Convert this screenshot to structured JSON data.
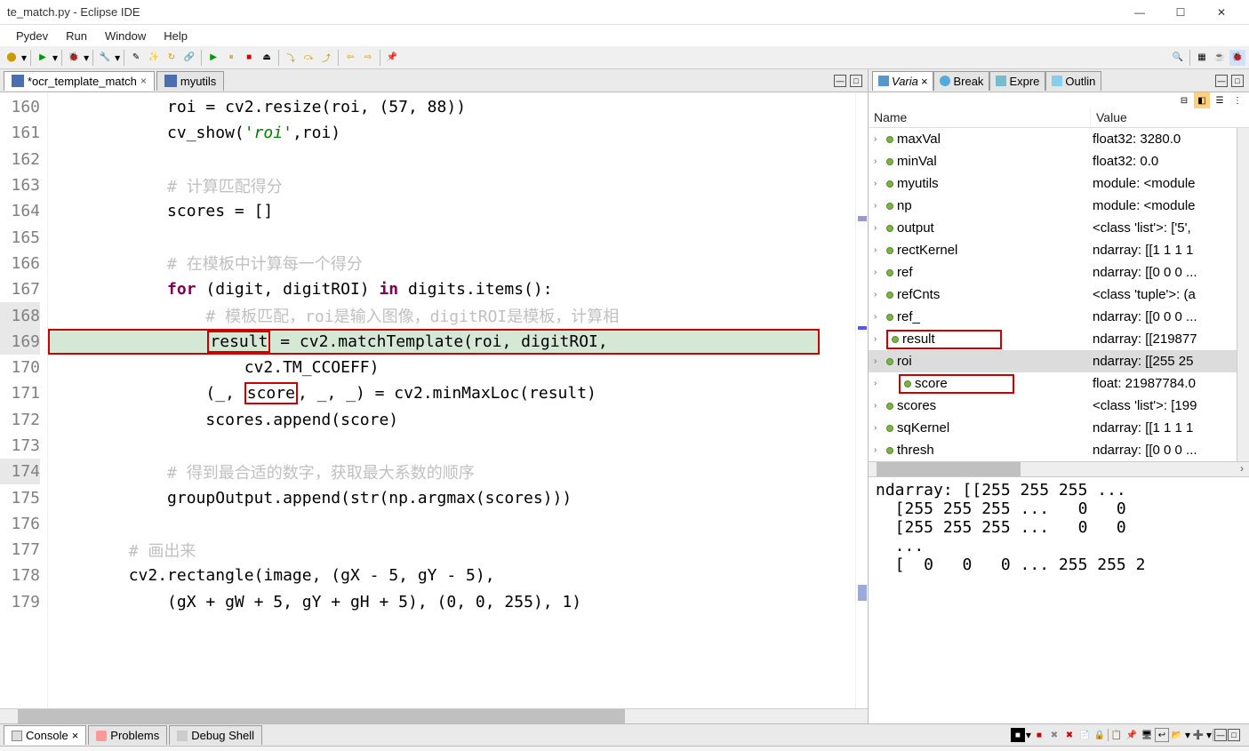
{
  "titlebar": "te_match.py - Eclipse IDE",
  "menu": {
    "pydev": "Pydev",
    "run": "Run",
    "window": "Window",
    "help": "Help"
  },
  "tabs": {
    "active": "*ocr_template_match",
    "second": "myutils"
  },
  "right_tabs": {
    "varia": "Varia",
    "break": "Break",
    "expre": "Expre",
    "outlin": "Outlin"
  },
  "bottom_tabs": {
    "console": "Console",
    "problems": "Problems",
    "debug_shell": "Debug Shell"
  },
  "editor_lines": [
    {
      "n": 160,
      "i": "            ",
      "seg": [
        {
          "t": "roi = cv2.resize(roi, ("
        },
        {
          "t": "57",
          "c": "num"
        },
        {
          "t": ", "
        },
        {
          "t": "88",
          "c": "num"
        },
        {
          "t": "))"
        }
      ]
    },
    {
      "n": 161,
      "i": "            ",
      "seg": [
        {
          "t": "cv_show("
        },
        {
          "t": "'roi'",
          "c": "str"
        },
        {
          "t": ",roi)"
        }
      ]
    },
    {
      "n": 162,
      "i": "",
      "seg": []
    },
    {
      "n": 163,
      "i": "            ",
      "seg": [
        {
          "t": "# 计算匹配得分",
          "c": "com"
        }
      ]
    },
    {
      "n": 164,
      "i": "            ",
      "seg": [
        {
          "t": "scores = []"
        }
      ]
    },
    {
      "n": 165,
      "i": "",
      "seg": []
    },
    {
      "n": 166,
      "i": "            ",
      "seg": [
        {
          "t": "# 在模板中计算每一个得分",
          "c": "com"
        }
      ]
    },
    {
      "n": 167,
      "i": "            ",
      "seg": [
        {
          "t": "for",
          "c": "kw"
        },
        {
          "t": " (digit, digitROI) "
        },
        {
          "t": "in",
          "c": "kw"
        },
        {
          "t": " digits.items():"
        }
      ]
    },
    {
      "n": 168,
      "hl": "gut",
      "i": "                ",
      "seg": [
        {
          "t": "# 模板匹配，roi是输入图像，digitROI是模板，计算相",
          "c": "com"
        }
      ]
    },
    {
      "n": 169,
      "hl": "line",
      "i": "                ",
      "seg": [
        {
          "t": "result",
          "box": true
        },
        {
          "t": " = cv2.matchTemplate(roi, digitROI,"
        }
      ]
    },
    {
      "n": 170,
      "i": "                    ",
      "seg": [
        {
          "t": "cv2.TM_CCOEFF)"
        }
      ]
    },
    {
      "n": 171,
      "i": "                ",
      "seg": [
        {
          "t": "(_, "
        },
        {
          "t": "score",
          "box": true
        },
        {
          "t": ", _, _) = cv2.minMaxLoc(result)"
        }
      ]
    },
    {
      "n": 172,
      "i": "                ",
      "seg": [
        {
          "t": "scores.append(score)"
        }
      ]
    },
    {
      "n": 173,
      "i": "",
      "seg": []
    },
    {
      "n": 174,
      "hl": "gut",
      "i": "            ",
      "seg": [
        {
          "t": "# 得到最合适的数字，获取最大系数的顺序",
          "c": "com"
        }
      ]
    },
    {
      "n": 175,
      "i": "            ",
      "seg": [
        {
          "t": "groupOutput.append(str(np.argmax(scores)))"
        }
      ]
    },
    {
      "n": 176,
      "i": "",
      "seg": []
    },
    {
      "n": 177,
      "i": "        ",
      "seg": [
        {
          "t": "# 画出来",
          "c": "com"
        }
      ]
    },
    {
      "n": 178,
      "i": "        ",
      "seg": [
        {
          "t": "cv2.rectangle(image, (gX - "
        },
        {
          "t": "5",
          "c": "num"
        },
        {
          "t": ", gY - "
        },
        {
          "t": "5",
          "c": "num"
        },
        {
          "t": "),"
        }
      ]
    },
    {
      "n": 179,
      "i": "            ",
      "seg": [
        {
          "t": "(gX + gW + "
        },
        {
          "t": "5",
          "c": "num"
        },
        {
          "t": ", gY + gH + "
        },
        {
          "t": "5",
          "c": "num"
        },
        {
          "t": "), ("
        },
        {
          "t": "0",
          "c": "num"
        },
        {
          "t": ", "
        },
        {
          "t": "0",
          "c": "num"
        },
        {
          "t": ", "
        },
        {
          "t": "255",
          "c": "num"
        },
        {
          "t": "), "
        },
        {
          "t": "1",
          "c": "num"
        },
        {
          "t": ")"
        }
      ]
    }
  ],
  "vars_header": {
    "name": "Name",
    "value": "Value"
  },
  "variables": [
    {
      "name": "maxVal",
      "value": "float32: 3280.0"
    },
    {
      "name": "minVal",
      "value": "float32: 0.0"
    },
    {
      "name": "myutils",
      "value": "module: <module"
    },
    {
      "name": "np",
      "value": "module: <module"
    },
    {
      "name": "output",
      "value": "<class 'list'>: ['5',"
    },
    {
      "name": "rectKernel",
      "value": "ndarray: [[1 1 1 1"
    },
    {
      "name": "ref",
      "value": "ndarray: [[0 0 0 ..."
    },
    {
      "name": "refCnts",
      "value": "<class 'tuple'>: (a"
    },
    {
      "name": "ref_",
      "value": "ndarray: [[0 0 0 ..."
    },
    {
      "name": "result",
      "value": "ndarray: [[219877",
      "box": true
    },
    {
      "name": "roi",
      "value": "ndarray: [[255 25",
      "selected": true
    },
    {
      "name": "score",
      "value": "float: 21987784.0",
      "box": true,
      "indent": true
    },
    {
      "name": "scores",
      "value": "<class 'list'>: [199"
    },
    {
      "name": "sqKernel",
      "value": "ndarray: [[1 1 1 1"
    },
    {
      "name": "thresh",
      "value": "ndarray: [[0 0 0 ..."
    }
  ],
  "value_pane": [
    "ndarray: [[255 255 255 ...",
    "  [255 255 255 ...   0   0",
    "  [255 255 255 ...   0   0",
    "  ...",
    "  [  0   0   0 ... 255 255 2"
  ]
}
